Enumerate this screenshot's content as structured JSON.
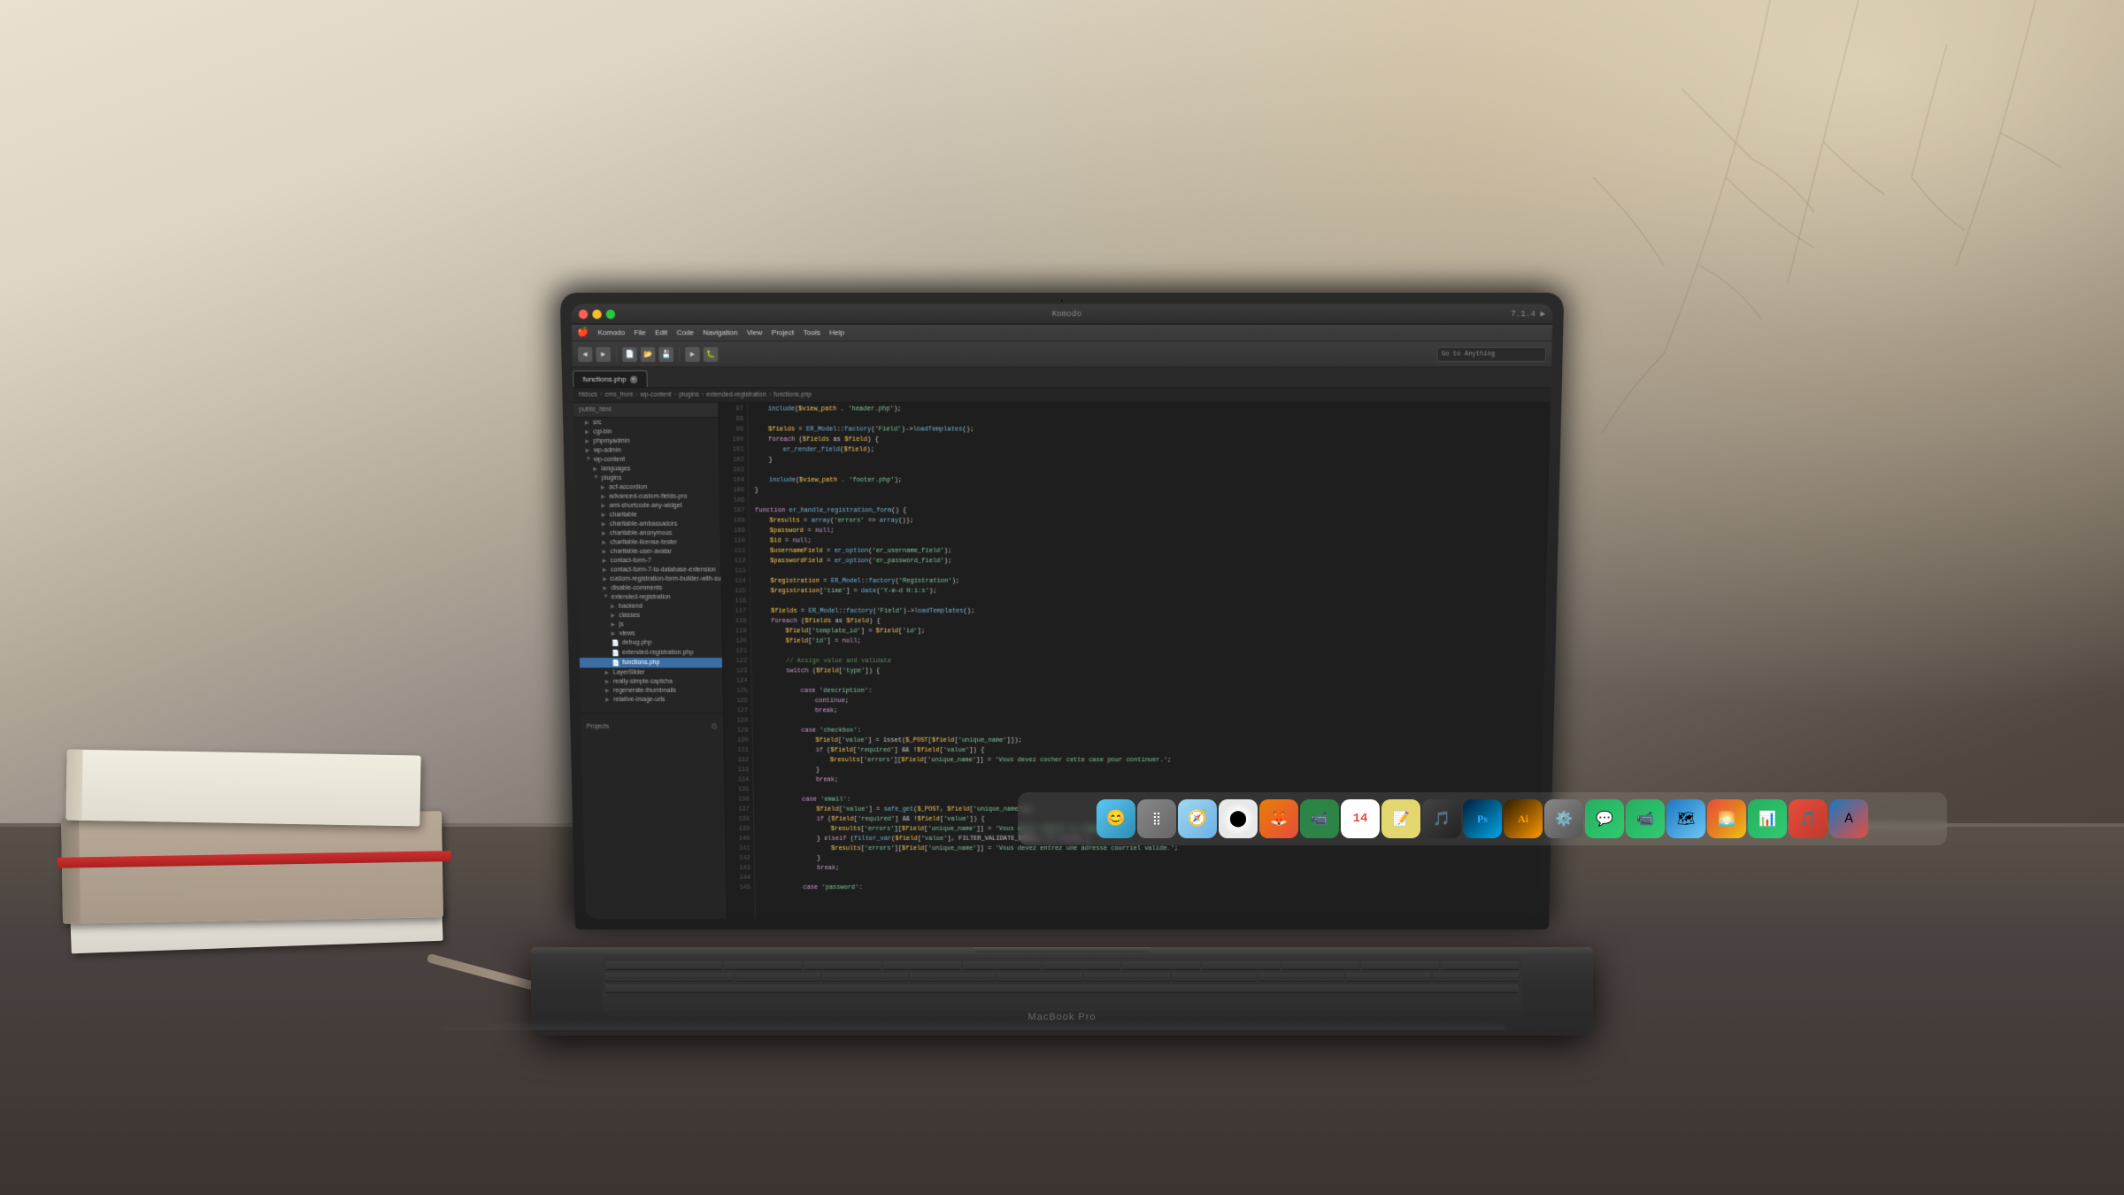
{
  "scene": {
    "laptop_brand": "MacBook Pro"
  },
  "komodo": {
    "title": "Komodo",
    "menu_items": [
      "Komodo",
      "File",
      "Edit",
      "Code",
      "Navigation",
      "View",
      "Project",
      "Tools",
      "Help"
    ],
    "status_right": "7.1.4 ▶",
    "tab_filename": "functions.php ×",
    "search_placeholder": "Go to Anything",
    "breadcrumbs": [
      "htdocs",
      "cms_front",
      "wp-content",
      "plugins",
      "extended-registration",
      "functions.php"
    ],
    "tree_header": "public_html",
    "projects_label": "Projects"
  },
  "dock": {
    "icons": [
      {
        "name": "finder",
        "label": "Finder",
        "symbol": "🔵"
      },
      {
        "name": "launchpad",
        "label": "Launchpad",
        "symbol": "🚀"
      },
      {
        "name": "safari",
        "label": "Safari",
        "symbol": "🧭"
      },
      {
        "name": "chrome",
        "label": "Chrome",
        "symbol": "🔵"
      },
      {
        "name": "firefox",
        "label": "Firefox",
        "symbol": "🦊"
      },
      {
        "name": "facetime",
        "label": "FaceTime",
        "symbol": "📹"
      },
      {
        "name": "calendar",
        "label": "Calendar",
        "symbol": "📅"
      },
      {
        "name": "notes",
        "label": "Notes",
        "symbol": "📝"
      },
      {
        "name": "itunes",
        "label": "iTunes",
        "symbol": "🎵"
      },
      {
        "name": "ps",
        "label": "Photoshop",
        "symbol": "Ps"
      },
      {
        "name": "ai",
        "label": "Illustrator",
        "symbol": "Ai"
      },
      {
        "name": "preferences",
        "label": "Preferences",
        "symbol": "⚙️"
      },
      {
        "name": "imessage",
        "label": "iMessage",
        "symbol": "💬"
      },
      {
        "name": "phone",
        "label": "Phone",
        "symbol": "📞"
      },
      {
        "name": "appstore",
        "label": "App Store",
        "symbol": "🅰"
      },
      {
        "name": "numbers",
        "label": "Numbers",
        "symbol": "📊"
      },
      {
        "name": "music",
        "label": "Music",
        "symbol": "🎵"
      },
      {
        "name": "maps",
        "label": "Maps",
        "symbol": "🗺"
      },
      {
        "name": "photos",
        "label": "Photos",
        "symbol": "🌅"
      }
    ]
  }
}
